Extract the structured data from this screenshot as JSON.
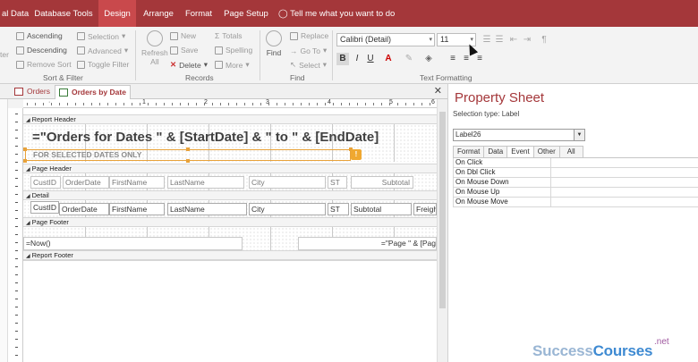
{
  "ribbon_tabs": [
    "al Data",
    "Database Tools",
    "Design",
    "Arrange",
    "Format",
    "Page Setup"
  ],
  "active_tab": "Design",
  "tell_me": "Tell me what you want to do",
  "sort_filter": {
    "ascending": "Ascending",
    "descending": "Descending",
    "remove_sort": "Remove Sort",
    "selection": "Selection",
    "advanced": "Advanced",
    "toggle_filter": "Toggle Filter",
    "filter_partial": "ter",
    "group_label": "Sort & Filter"
  },
  "records": {
    "refresh": "Refresh",
    "refresh_all": "All",
    "new": "New",
    "save": "Save",
    "delete": "Delete",
    "totals": "Totals",
    "spelling": "Spelling",
    "more": "More",
    "group_label": "Records"
  },
  "find": {
    "find": "Find",
    "replace": "Replace",
    "goto": "Go To",
    "select": "Select",
    "group_label": "Find"
  },
  "text_formatting": {
    "font": "Calibri (Detail)",
    "size": "11",
    "bold": "B",
    "italic": "I",
    "underline": "U",
    "group_label": "Text Formatting"
  },
  "doc_tabs": [
    {
      "label": "Orders",
      "active": false
    },
    {
      "label": "Orders by Date",
      "active": true
    }
  ],
  "ruler_numbers": [
    "1",
    "2",
    "3",
    "4",
    "5",
    "6"
  ],
  "design": {
    "sections": {
      "report_header": "Report Header",
      "page_header": "Page Header",
      "detail": "Detail",
      "page_footer": "Page Footer",
      "report_footer": "Report Footer"
    },
    "title_expr": "=\"Orders for Dates \" & [StartDate] & \" to \" & [EndDate]",
    "subtitle": "FOR SELECTED DATES ONLY",
    "header_labels": [
      "CustID",
      "OrderDate",
      "FirstName",
      "LastName",
      "City",
      "ST",
      "Subtotal"
    ],
    "detail_fields": [
      "CustID",
      "OrderDate",
      "FirstName",
      "LastName",
      "City",
      "ST",
      "Subtotal",
      "Freigh"
    ],
    "footer_now": "=Now()",
    "footer_page": "=\"Page \" & [Pag"
  },
  "property_sheet": {
    "title": "Property Sheet",
    "selection_type": "Selection type:  Label",
    "selected": "Label26",
    "tabs": [
      "Format",
      "Data",
      "Event",
      "Other",
      "All"
    ],
    "active_tab": "Event",
    "rows": [
      "On Click",
      "On Dbl Click",
      "On Mouse Down",
      "On Mouse Up",
      "On Mouse Move"
    ]
  },
  "watermark": {
    "part1": "Success",
    "part2": "Courses",
    "tld": ".net"
  },
  "colors": {
    "brand": "#a4373a",
    "selection": "#e8a23a"
  }
}
